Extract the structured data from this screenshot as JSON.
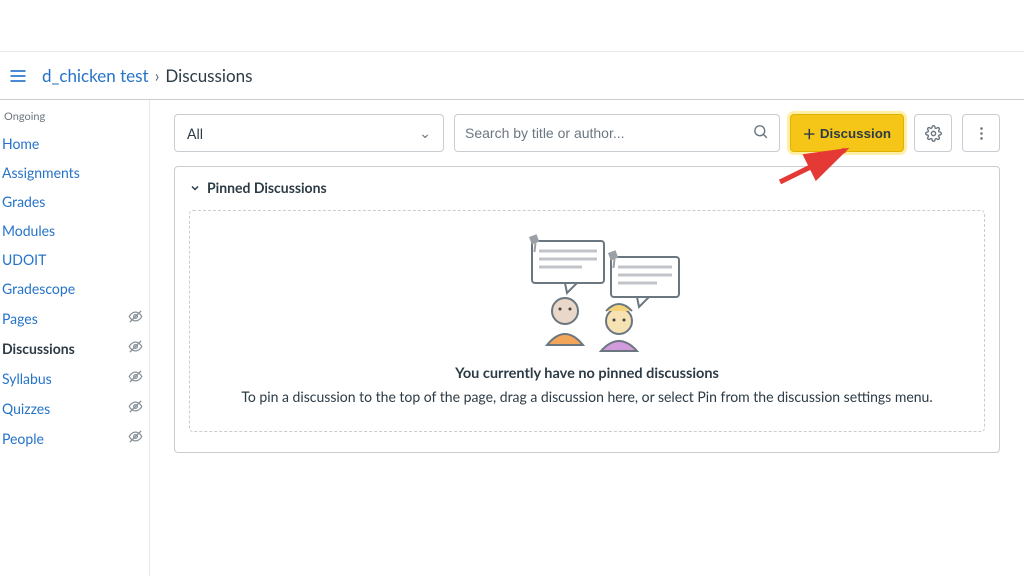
{
  "breadcrumb": {
    "course": "d_chicken test",
    "current": "Discussions"
  },
  "sidebar": {
    "heading": "Ongoing",
    "items": [
      {
        "label": "Home",
        "hidden": false
      },
      {
        "label": "Assignments",
        "hidden": false
      },
      {
        "label": "Grades",
        "hidden": false
      },
      {
        "label": "Modules",
        "hidden": false
      },
      {
        "label": "UDOIT",
        "hidden": false
      },
      {
        "label": "Gradescope",
        "hidden": false
      },
      {
        "label": "Pages",
        "hidden": true
      },
      {
        "label": "Discussions",
        "hidden": true,
        "active": true
      },
      {
        "label": "Syllabus",
        "hidden": true
      },
      {
        "label": "Quizzes",
        "hidden": true
      },
      {
        "label": "People",
        "hidden": true
      }
    ]
  },
  "toolbar": {
    "filter_value": "All",
    "search_placeholder": "Search by title or author...",
    "add_label": "Discussion"
  },
  "panel": {
    "title": "Pinned Discussions",
    "empty_title": "You currently have no pinned discussions",
    "empty_sub": "To pin a discussion to the top of the page, drag a discussion here, or select Pin from the discussion settings menu."
  },
  "colors": {
    "highlight": "#f5c518",
    "link": "#2573c9"
  }
}
